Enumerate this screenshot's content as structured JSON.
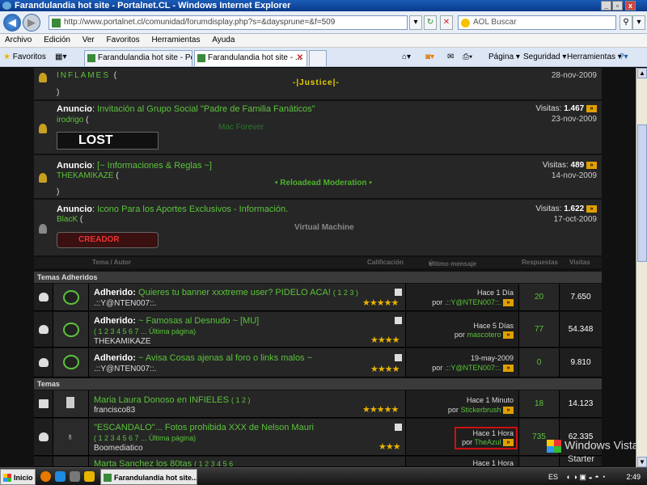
{
  "window": {
    "title": "Farandulandia hot site - Portalnet.CL - Windows Internet Explorer",
    "min": "_",
    "max": "▫",
    "close": "x"
  },
  "address": {
    "url": "http://www.portalnet.cl/comunidad/forumdisplay.php?s=&daysprune=&f=509",
    "search_placeholder": "AOL Buscar"
  },
  "menu": [
    "Archivo",
    "Edición",
    "Ver",
    "Favoritos",
    "Herramientas",
    "Ayuda"
  ],
  "tabs": {
    "favorites": "Favoritos",
    "tab1": "Farandulandia hot site - Port...",
    "tab2": "Farandulandia hot site - ..."
  },
  "commands": {
    "page": "Página",
    "security": "Seguridad",
    "tools": "Herramientas"
  },
  "announcements": [
    {
      "author": "INFLAMES",
      "paren_open": "(",
      "signature": "-|Justice|-",
      "paren_close": ")",
      "date": "28-nov-2009"
    },
    {
      "label": "Anuncio",
      "title": "Invitación al Grupo Social \"Padre de Familia Fanáticos\"",
      "author": "irodrigo",
      "paren_open": "(",
      "signature": "Mac Forever",
      "banner": "LOST",
      "views_label": "Visitas:",
      "views": "1.467",
      "date": "23-nov-2009"
    },
    {
      "label": "Anuncio",
      "title": "[~ Informaciones & Reglas ~]",
      "author": "THEKAMIKAZE",
      "paren_open": "(",
      "signature": "• Reloadead Moderation •",
      "paren_close": ")",
      "views_label": "Visitas:",
      "views": "489",
      "date": "14-nov-2009"
    },
    {
      "label": "Anuncio",
      "title": "Icono Para los Aportes Exclusivos - Información.",
      "author": "BlacK",
      "paren_open": "(",
      "signature": "Virtual Machine",
      "banner": "CREADOR",
      "views_label": "Visitas:",
      "views": "1.622",
      "date": "17-oct-2009"
    }
  ],
  "columns": {
    "topic": "Tema / Autor",
    "rating": "Calificación",
    "last_post": "Último mensaje",
    "replies": "Respuestas",
    "views": "Visitas"
  },
  "sections": {
    "sticky": "Temas Adheridos",
    "threads": "Temas"
  },
  "sticky": [
    {
      "prefix": "Adherido:",
      "title": "Quieres tu banner xxxtreme user? PIDELO ACA!",
      "pages": "( 1 2 3 )",
      "author": ".::Y@NTEN007::.",
      "stars": "★★★★★",
      "lp_time": "Hace 1 Día",
      "lp_by": "por",
      "lp_user": ".::Y@NTEN007::.",
      "replies": "20",
      "views": "7.650"
    },
    {
      "prefix": "Adherido:",
      "title": "~ Famosas al Desnudo ~ [MU]",
      "pages": "( 1 2 3 4 5 6 7 ... Última página)",
      "author": "THEKAMIKAZE",
      "stars": "★★★★",
      "lp_time": "Hace 5 Días",
      "lp_by": "por",
      "lp_user": "mascotero",
      "replies": "77",
      "views": "54.348"
    },
    {
      "prefix": "Adherido:",
      "title": "~ Avisa Cosas ajenas al foro o links malos ~",
      "author": ".::Y@NTEN007::.",
      "stars": "★★★★",
      "lp_time": "19-may-2009",
      "lp_by": "por",
      "lp_user": ".::Y@NTEN007::.",
      "replies": "0",
      "views": "9.810"
    }
  ],
  "threads": [
    {
      "title": "Maria Laura Donoso en INFIELES",
      "pages": "( 1 2 )",
      "author": "francisco83",
      "stars": "★★★★★",
      "lp_time": "Hace 1 Minuto",
      "lp_by": "por",
      "lp_user": "Stickerbrush",
      "replies": "18",
      "views": "14.123"
    },
    {
      "title": "\"ESCANDALO\"... Fotos prohibida XXX de Nelson Mauri",
      "pages": "( 1 2 3 4 5 6 7 ... Última página)",
      "author": "Boomediatico",
      "stars": "★★★",
      "lp_time": "Hace 1 Hora",
      "lp_by": "por",
      "lp_user": "TheAzul",
      "replies": "735",
      "views": "62.335"
    },
    {
      "title": "Marta Sanchez los 80tas",
      "pages": "( 1 2 3 4 5 6",
      "lp_time": "Hace 1 Hora"
    }
  ],
  "watermark": {
    "line1": "Windows Vista",
    "line2": "Starter"
  },
  "taskbar": {
    "start": "Inicio",
    "task": "Farandulandia hot site...",
    "lang": "ES",
    "time": "2:49"
  },
  "colors": {
    "link_green": "#5cc33c",
    "row_bg": "#262626",
    "highlight_red": "#d01010"
  }
}
